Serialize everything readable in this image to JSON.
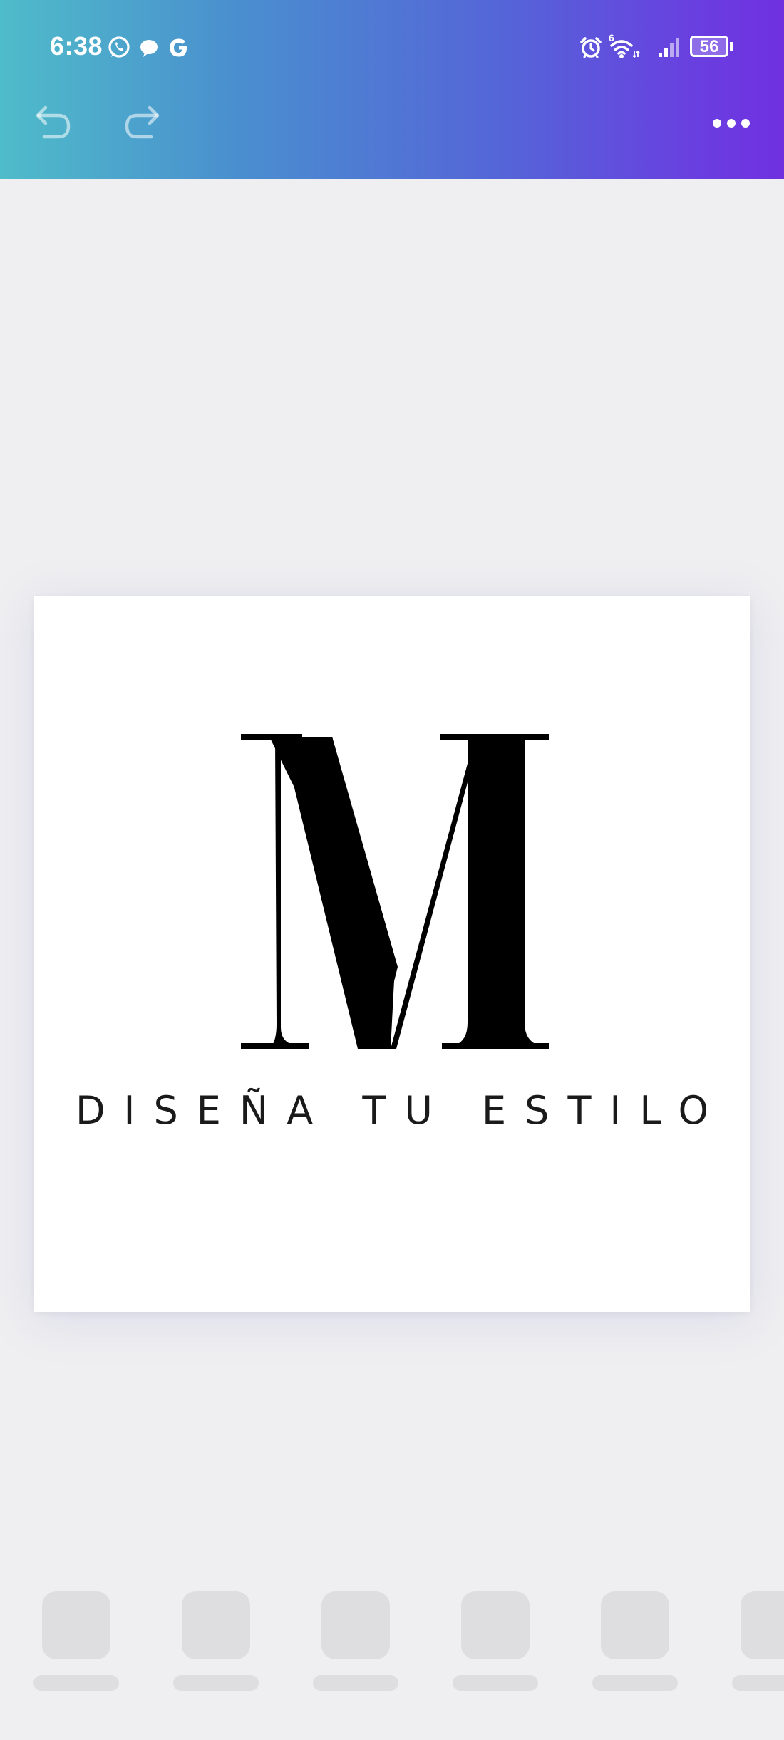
{
  "status_bar": {
    "time": "6:38",
    "battery_level": "56",
    "left_icons": [
      "whatsapp-icon",
      "chat-bubble-icon",
      "google-icon"
    ],
    "right_icons": [
      "alarm-icon",
      "wifi-6-icon",
      "signal-icon",
      "battery-icon"
    ],
    "wifi_badge": "6"
  },
  "toolbar": {
    "undo_icon": "undo-icon",
    "redo_icon": "redo-icon",
    "more_icon": "more-horizontal-icon"
  },
  "colors": {
    "gradient_start": "#4fbcc9",
    "gradient_end": "#7030e0",
    "canvas_background": "#efeff1",
    "card_background": "#ffffff",
    "logo_ink": "#000000",
    "skeleton": "#dedee0"
  },
  "design": {
    "monogram": "M",
    "tagline": "DISEÑA TU ESTILO"
  },
  "bottom_tray": {
    "state": "loading",
    "placeholder_count": 6
  }
}
